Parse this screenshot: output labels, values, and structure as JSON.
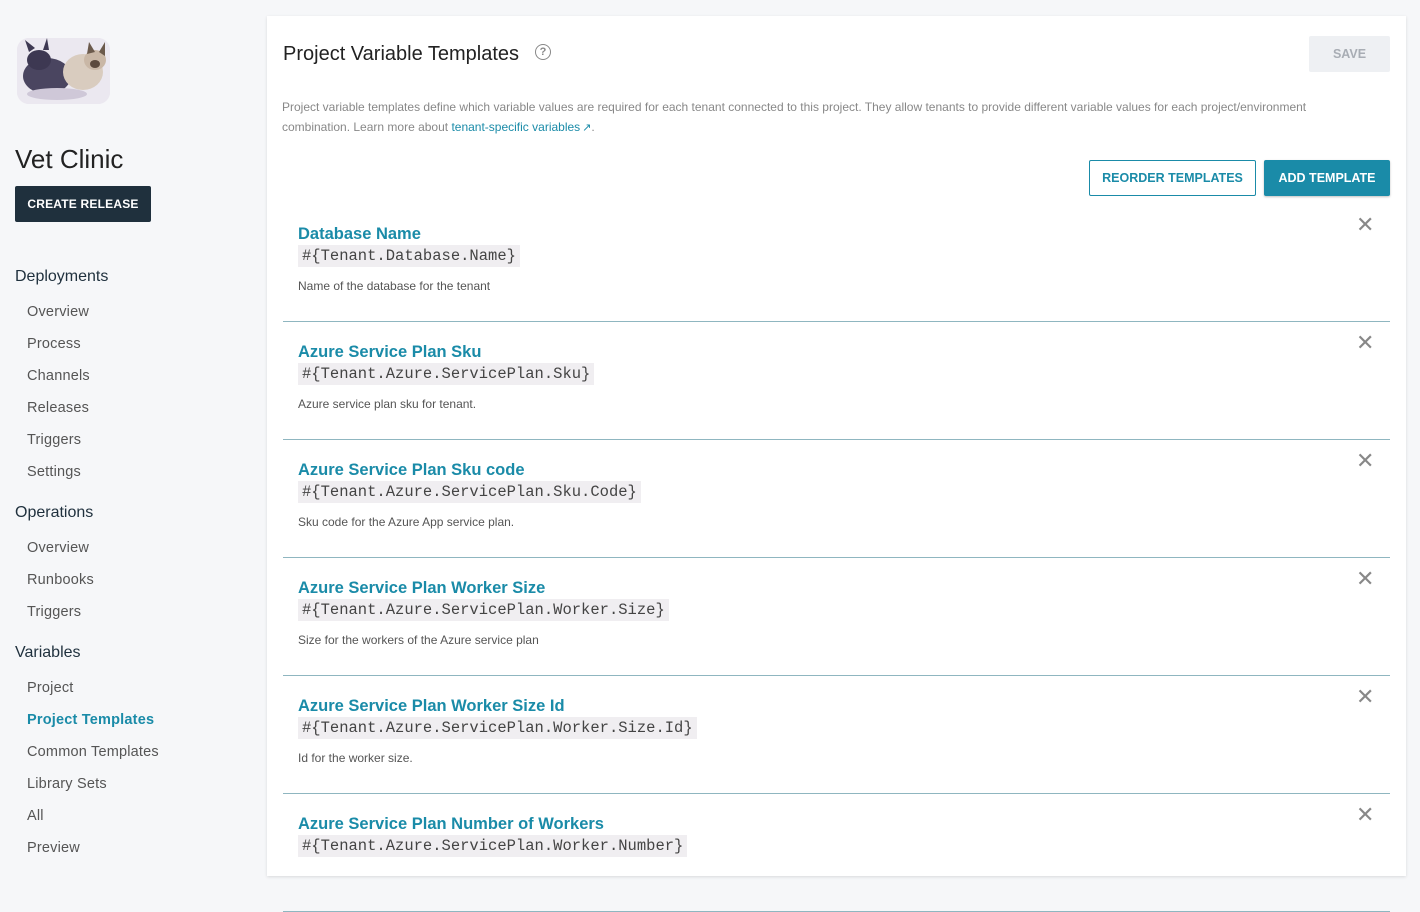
{
  "project": {
    "name": "Vet Clinic",
    "create_release_label": "CREATE RELEASE"
  },
  "nav": {
    "deployments": {
      "label": "Deployments",
      "items": [
        "Overview",
        "Process",
        "Channels",
        "Releases",
        "Triggers",
        "Settings"
      ]
    },
    "operations": {
      "label": "Operations",
      "items": [
        "Overview",
        "Runbooks",
        "Triggers"
      ]
    },
    "variables": {
      "label": "Variables",
      "items": [
        "Project",
        "Project Templates",
        "Common Templates",
        "Library Sets",
        "All",
        "Preview"
      ],
      "active": "Project Templates"
    }
  },
  "page": {
    "title": "Project Variable Templates",
    "help_icon": "?",
    "save_label": "SAVE",
    "description": "Project variable templates define which variable values are required for each tenant connected to this project. They allow tenants to provide different variable values for each project/environment combination. Learn more about ",
    "description_link": "tenant-specific variables",
    "description_end": ".",
    "external_link_icon": "↗",
    "reorder_label": "REORDER TEMPLATES",
    "add_label": "ADD TEMPLATE"
  },
  "templates": [
    {
      "name": "Database Name",
      "variable": "#{Tenant.Database.Name}",
      "help": "Name of the database for the tenant"
    },
    {
      "name": "Azure Service Plan Sku",
      "variable": "#{Tenant.Azure.ServicePlan.Sku}",
      "help": "Azure service plan sku for tenant."
    },
    {
      "name": "Azure Service Plan Sku code",
      "variable": "#{Tenant.Azure.ServicePlan.Sku.Code}",
      "help": "Sku code for the Azure App service plan."
    },
    {
      "name": "Azure Service Plan Worker Size",
      "variable": "#{Tenant.Azure.ServicePlan.Worker.Size}",
      "help": "Size for the workers of the Azure service plan"
    },
    {
      "name": "Azure Service Plan Worker Size Id",
      "variable": "#{Tenant.Azure.ServicePlan.Worker.Size.Id}",
      "help": "Id for the worker size."
    },
    {
      "name": "Azure Service Plan Number of Workers",
      "variable": "#{Tenant.Azure.ServicePlan.Worker.Number}",
      "help": ""
    }
  ],
  "close_icon": "✕"
}
